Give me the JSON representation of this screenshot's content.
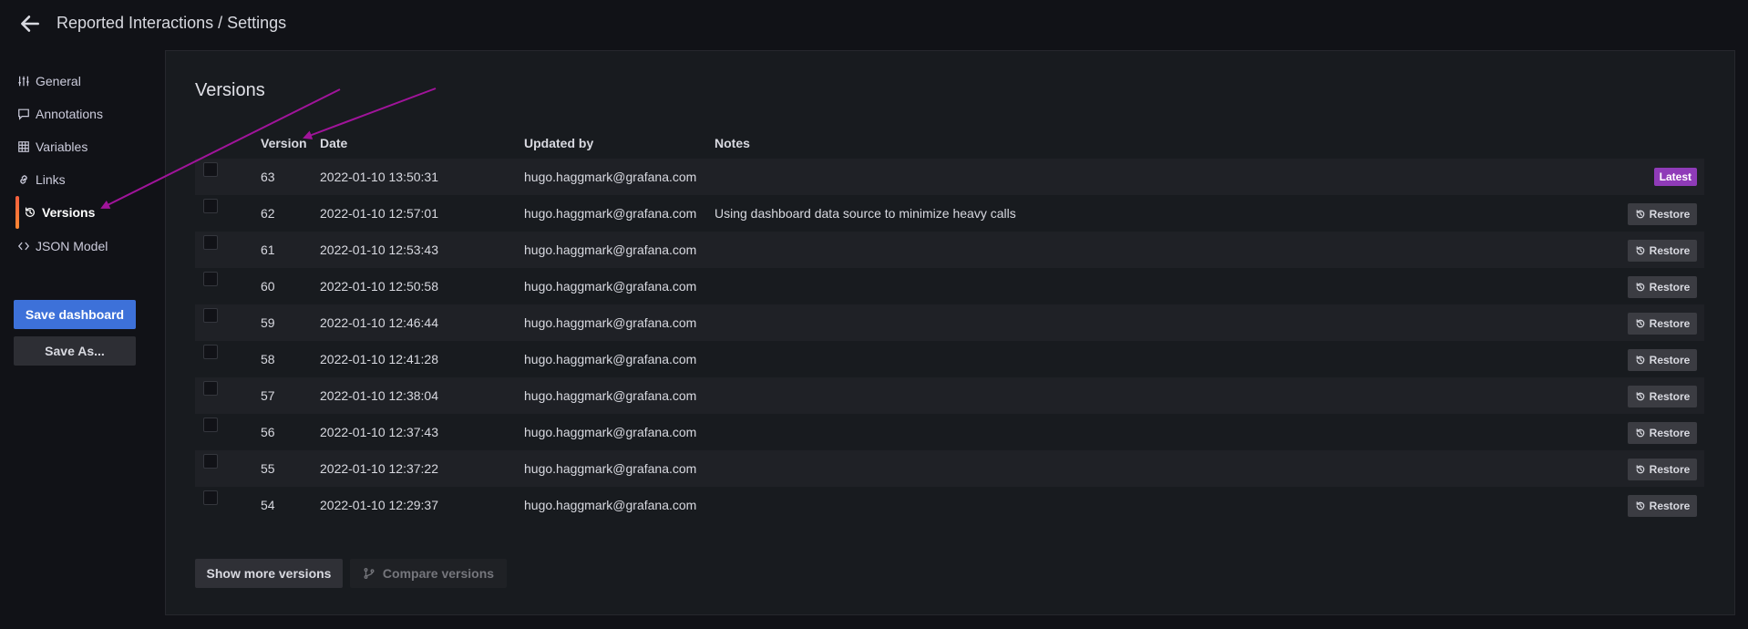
{
  "header": {
    "title": "Reported Interactions / Settings"
  },
  "sidebar": {
    "items": [
      {
        "label": "General",
        "icon": "sliders-icon"
      },
      {
        "label": "Annotations",
        "icon": "comment-icon"
      },
      {
        "label": "Variables",
        "icon": "grid-icon"
      },
      {
        "label": "Links",
        "icon": "link-icon"
      },
      {
        "label": "Versions",
        "icon": "history-icon",
        "active": true
      },
      {
        "label": "JSON Model",
        "icon": "code-icon"
      }
    ],
    "save_label": "Save dashboard",
    "save_as_label": "Save As..."
  },
  "main": {
    "title": "Versions",
    "columns": [
      "Version",
      "Date",
      "Updated by",
      "Notes"
    ],
    "rows": [
      {
        "version": "63",
        "date": "2022-01-10 13:50:31",
        "user": "hugo.haggmark@grafana.com",
        "notes": "",
        "latest": true
      },
      {
        "version": "62",
        "date": "2022-01-10 12:57:01",
        "user": "hugo.haggmark@grafana.com",
        "notes": "Using dashboard data source to minimize heavy calls"
      },
      {
        "version": "61",
        "date": "2022-01-10 12:53:43",
        "user": "hugo.haggmark@grafana.com",
        "notes": ""
      },
      {
        "version": "60",
        "date": "2022-01-10 12:50:58",
        "user": "hugo.haggmark@grafana.com",
        "notes": ""
      },
      {
        "version": "59",
        "date": "2022-01-10 12:46:44",
        "user": "hugo.haggmark@grafana.com",
        "notes": ""
      },
      {
        "version": "58",
        "date": "2022-01-10 12:41:28",
        "user": "hugo.haggmark@grafana.com",
        "notes": ""
      },
      {
        "version": "57",
        "date": "2022-01-10 12:38:04",
        "user": "hugo.haggmark@grafana.com",
        "notes": ""
      },
      {
        "version": "56",
        "date": "2022-01-10 12:37:43",
        "user": "hugo.haggmark@grafana.com",
        "notes": ""
      },
      {
        "version": "55",
        "date": "2022-01-10 12:37:22",
        "user": "hugo.haggmark@grafana.com",
        "notes": ""
      },
      {
        "version": "54",
        "date": "2022-01-10 12:29:37",
        "user": "hugo.haggmark@grafana.com",
        "notes": ""
      }
    ],
    "latest_label": "Latest",
    "restore_label": "Restore",
    "show_more_label": "Show more versions",
    "compare_label": "Compare versions"
  },
  "colors": {
    "accent": "#3d71d9",
    "latest_badge": "#8f3bb8",
    "annotation_arrow": "#a0149a",
    "active_indicator": "#f55f3e"
  }
}
